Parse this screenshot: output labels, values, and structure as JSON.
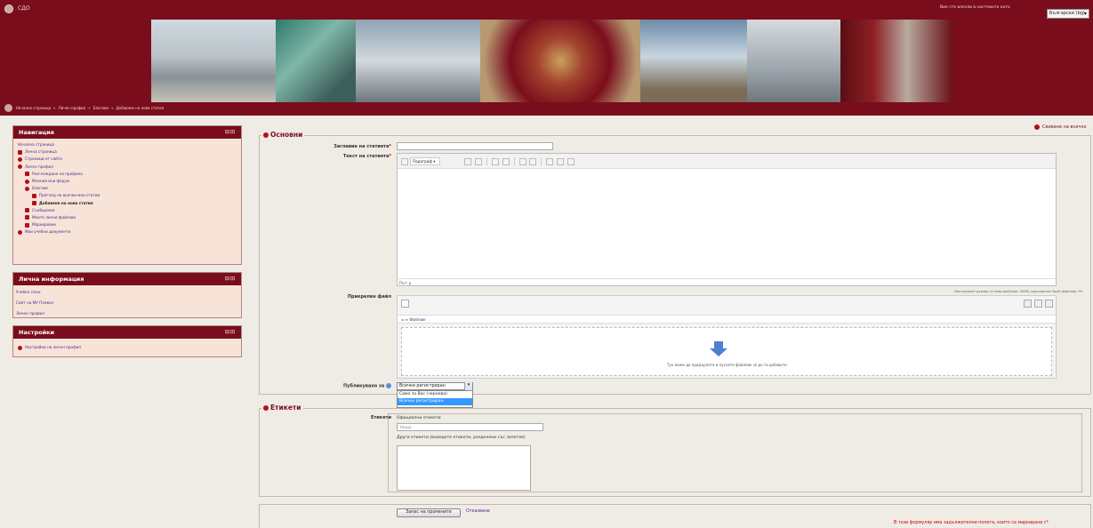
{
  "header": {
    "site_name": "СДО",
    "login_text": "Вие сте влезли в системата като",
    "language": "Български (bg)"
  },
  "breadcrumb": [
    "Начална страница",
    "Личен профил",
    "Блогове",
    "Добавяне на нова статия"
  ],
  "navigation": {
    "title": "Навигация",
    "controls": "⊟⊡",
    "items": [
      {
        "label": "Начална страница",
        "icon": "none",
        "indent": 0
      },
      {
        "label": "Лична страница",
        "icon": "page",
        "indent": 0
      },
      {
        "label": "Страници от сайта",
        "icon": "dot",
        "indent": 0
      },
      {
        "label": "Личен профил",
        "icon": "dot",
        "indent": 0
      },
      {
        "label": "Разглеждане на профила",
        "icon": "page",
        "indent": 1
      },
      {
        "label": "Мнения във форум",
        "icon": "dot",
        "indent": 1
      },
      {
        "label": "Блогове",
        "icon": "dot",
        "indent": 1
      },
      {
        "label": "Преглед на всички мои статии",
        "icon": "page",
        "indent": 2
      },
      {
        "label": "Добавяне на нова статия",
        "icon": "page",
        "indent": 2,
        "active": true
      },
      {
        "label": "Съобщения",
        "icon": "page",
        "indent": 1
      },
      {
        "label": "Моите лични файлове",
        "icon": "page",
        "indent": 1
      },
      {
        "label": "Маркировки",
        "icon": "page",
        "indent": 1
      },
      {
        "label": "Мои учебни документи",
        "icon": "dot",
        "indent": 0
      }
    ]
  },
  "personal_info": {
    "title": "Лична информация",
    "controls": "⊟⊡",
    "items": [
      "Учебен план",
      "Сайт на МУ Плевен",
      "Личен профил"
    ]
  },
  "settings": {
    "title": "Настройки",
    "controls": "⊟⊡",
    "items": [
      "Настройки на личен профил"
    ]
  },
  "form": {
    "collapse_all": "Свиване на всичко",
    "basics_legend": "Основни",
    "title_label": "Заглавие на статията",
    "text_label": "Текст на статията",
    "editor_format": "Параграф",
    "editor_path": "Път: p",
    "attach_label": "Прикрепен файл",
    "attach_limits": "Максимален размер за нови файлове: 50MB, максимален брой файлове: 99",
    "files_folder": "Файлове",
    "drop_text": "Тук може да придърпате и пуснете файлове за да ги добавите.",
    "publish_label": "Публикувано за",
    "publish_value": "Всички регистриран",
    "publish_options": [
      "Само за Вас (чернова)",
      "Всички регистриран"
    ],
    "tags_legend": "Етикети",
    "tags_label": "Етикети",
    "official_tags_label": "Официални етикети",
    "official_tags_value": "Нищо",
    "other_tags_label": "Други етикети (въведете етикети, разделени със запетая)",
    "save_button": "Запис на промените",
    "cancel_link": "Отказване",
    "required_note": "В този формуляр има задължителни полета, които са маркирани с"
  },
  "colors": {
    "header_bg": "#7a0d1c",
    "accent": "#b0101f"
  }
}
